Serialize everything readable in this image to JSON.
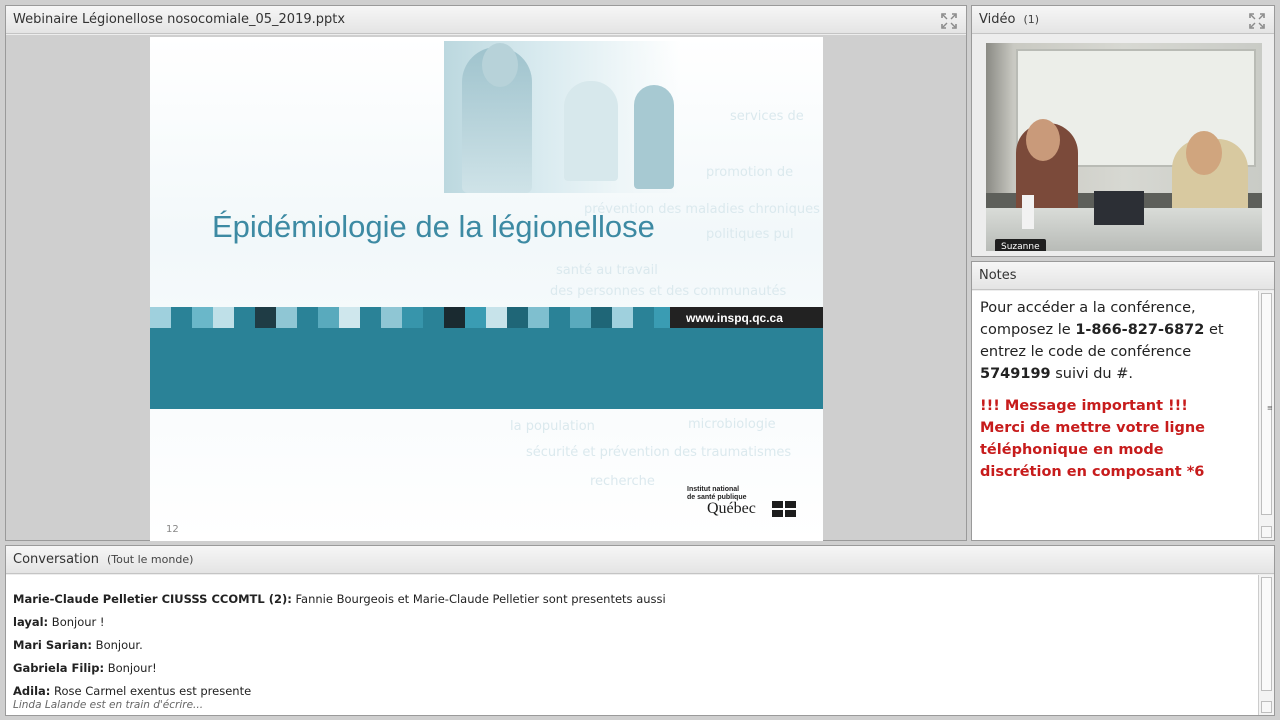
{
  "share_pod": {
    "title": "Webinaire Légionellose nosocomiale_05_2019.pptx",
    "fullscreen_icon": "expand-icon",
    "slide": {
      "title": "Épidémiologie de la légionellose",
      "url": "www.inspq.qc.ca",
      "page_number": "12",
      "logo_line1": "Institut national",
      "logo_line2": "de santé publique",
      "logo_name": "Québec",
      "ghost_words": [
        "promotion de",
        "prévention des maladies chroniques",
        "santé au travail",
        "des personnes et des communautés",
        "la population",
        "microbiologie",
        "sécurité et prévention des traumatismes",
        "recherche",
        "politiques pul",
        "services de"
      ]
    },
    "brand_colors": {
      "band": "#2a8297",
      "title": "#3d8aa3"
    }
  },
  "video_pod": {
    "title": "Vidéo",
    "count": "(1)",
    "participant_name": "Suzanne",
    "fullscreen_icon": "expand-icon"
  },
  "notes_pod": {
    "title": "Notes",
    "line1": "Pour accéder a la conférence,",
    "line2_pre": "composez le ",
    "phone": "1-866-827-6872",
    "line2_post": " et",
    "line3": "entrez le code de conférence",
    "code": "5749199",
    "line4_post": " suivi du #.",
    "important_1": "!!! Message important !!!",
    "important_2": "Merci de mettre votre ligne téléphonique en mode discrétion en composant *6",
    "important_color": "#c71c1c"
  },
  "chat_pod": {
    "title": "Conversation",
    "audience": "(Tout le monde)",
    "messages": [
      {
        "who": "Marie-Claude Pelletier CIUSSS CCOMTL (2):",
        "text": " Fannie Bourgeois et Marie-Claude Pelletier sont presentets aussi"
      },
      {
        "who": "layal:",
        "text": " Bonjour !"
      },
      {
        "who": "Mari Sarian:",
        "text": " Bonjour."
      },
      {
        "who": "Gabriela Filip:",
        "text": " Bonjour!"
      },
      {
        "who": "Adila:",
        "text": " Rose Carmel exentus est presente"
      }
    ],
    "typing": "Linda Lalande est en train d'écrire..."
  }
}
